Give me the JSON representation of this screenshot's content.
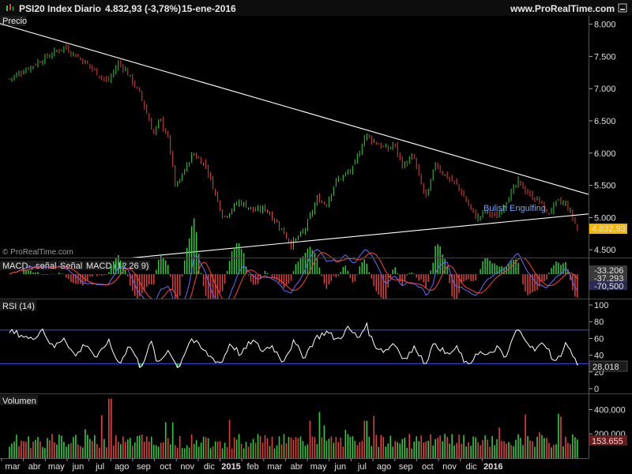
{
  "header": {
    "symbol": "PSI20 Index",
    "period": "Diario",
    "quote": "4.832,93 (-3,78%)",
    "date": "15-ene-2016",
    "site": "www.ProRealTime.com",
    "watermark": "© ProRealTime.com"
  },
  "colors": {
    "up": "#2ecc40",
    "down": "#e04040",
    "price_tag": "#f5b800",
    "rsi_lines": "#3050ff",
    "trend_lines": "#ffffff"
  },
  "chart_data": [
    {
      "type": "candlestick",
      "title": "Precio",
      "ylim": [
        4380,
        8130
      ],
      "yticks": [
        4500,
        5000,
        5500,
        6000,
        6500,
        7000,
        7500,
        8000
      ],
      "ytick_labels": [
        "4.500",
        "5.000",
        "5.500",
        "6.000",
        "6.500",
        "7.000",
        "7.500",
        "8.000"
      ],
      "last_value_label": "4.832,93",
      "last_value": 4832.93,
      "annotation": "Bulish Engulfing",
      "closing_path": [
        {
          "x": 0,
          "y": 7150
        },
        {
          "x": 2.5,
          "y": 7650
        },
        {
          "x": 3.5,
          "y": 7400
        },
        {
          "x": 4.5,
          "y": 7100
        },
        {
          "x": 5.0,
          "y": 7400
        },
        {
          "x": 5.3,
          "y": 7300
        },
        {
          "x": 6.0,
          "y": 6900
        },
        {
          "x": 6.6,
          "y": 6300
        },
        {
          "x": 6.9,
          "y": 6530
        },
        {
          "x": 7.3,
          "y": 6200
        },
        {
          "x": 7.6,
          "y": 5450
        },
        {
          "x": 8.4,
          "y": 6000
        },
        {
          "x": 9.0,
          "y": 5800
        },
        {
          "x": 9.3,
          "y": 5500
        },
        {
          "x": 9.8,
          "y": 5000
        },
        {
          "x": 10.5,
          "y": 5250
        },
        {
          "x": 11.3,
          "y": 5100
        },
        {
          "x": 11.7,
          "y": 5150
        },
        {
          "x": 12.4,
          "y": 4850
        },
        {
          "x": 12.9,
          "y": 4580
        },
        {
          "x": 13.5,
          "y": 4800
        },
        {
          "x": 14.1,
          "y": 5300
        },
        {
          "x": 14.5,
          "y": 5200
        },
        {
          "x": 14.9,
          "y": 5550
        },
        {
          "x": 15.7,
          "y": 5750
        },
        {
          "x": 16.0,
          "y": 6000
        },
        {
          "x": 16.3,
          "y": 6300
        },
        {
          "x": 16.6,
          "y": 6200
        },
        {
          "x": 17.3,
          "y": 6050
        },
        {
          "x": 17.6,
          "y": 6150
        },
        {
          "x": 18.0,
          "y": 5800
        },
        {
          "x": 18.5,
          "y": 5950
        },
        {
          "x": 18.8,
          "y": 5550
        },
        {
          "x": 19.1,
          "y": 5300
        },
        {
          "x": 19.5,
          "y": 5850
        },
        {
          "x": 19.8,
          "y": 5700
        },
        {
          "x": 20.5,
          "y": 5500
        },
        {
          "x": 21.0,
          "y": 5200
        },
        {
          "x": 21.4,
          "y": 4980
        },
        {
          "x": 21.8,
          "y": 5100
        },
        {
          "x": 22.3,
          "y": 5000
        },
        {
          "x": 22.7,
          "y": 5250
        },
        {
          "x": 23.3,
          "y": 5550
        },
        {
          "x": 23.8,
          "y": 5350
        },
        {
          "x": 24.3,
          "y": 5250
        },
        {
          "x": 24.6,
          "y": 5050
        },
        {
          "x": 25.1,
          "y": 5250
        },
        {
          "x": 25.5,
          "y": 5200
        },
        {
          "x": 25.8,
          "y": 4980
        },
        {
          "x": 26.0,
          "y": 4832.93
        }
      ],
      "trendlines": [
        {
          "name": "resistance",
          "x": [
            1.5,
            26.0
          ],
          "y": [
            7820,
            5410
          ]
        },
        {
          "name": "support",
          "x": [
            7.0,
            26.0
          ],
          "y": [
            4420,
            5040
          ]
        }
      ]
    },
    {
      "type": "line",
      "title": "MACD",
      "legend": [
        "MACD-, señal",
        "Señal",
        "MACD (12 26 9)"
      ],
      "ylim": [
        -200,
        120
      ],
      "value_labels": [
        "-33,206",
        "-37,293",
        "-70,500"
      ],
      "values": [
        -33.206,
        -37.293,
        -70.5
      ]
    },
    {
      "type": "line",
      "title": "RSI (14)",
      "ylim": [
        0,
        100
      ],
      "yticks": [
        0,
        20,
        40,
        60,
        80,
        100
      ],
      "ytick_labels": [
        "0",
        "20",
        "40",
        "60",
        "80",
        "100"
      ],
      "bands": [
        30,
        70
      ],
      "last_value_label": "28,018",
      "last_value": 28.018,
      "path": [
        {
          "x": 0,
          "y": 68
        },
        {
          "x": 0.5,
          "y": 65
        },
        {
          "x": 1.0,
          "y": 58
        },
        {
          "x": 1.5,
          "y": 72
        },
        {
          "x": 2.0,
          "y": 48
        },
        {
          "x": 2.5,
          "y": 62
        },
        {
          "x": 3.0,
          "y": 38
        },
        {
          "x": 3.5,
          "y": 55
        },
        {
          "x": 4.0,
          "y": 35
        },
        {
          "x": 4.5,
          "y": 58
        },
        {
          "x": 5.0,
          "y": 30
        },
        {
          "x": 5.5,
          "y": 52
        },
        {
          "x": 6.0,
          "y": 26
        },
        {
          "x": 6.5,
          "y": 55
        },
        {
          "x": 6.8,
          "y": 28
        },
        {
          "x": 7.3,
          "y": 48
        },
        {
          "x": 7.7,
          "y": 24
        },
        {
          "x": 8.3,
          "y": 60
        },
        {
          "x": 8.7,
          "y": 50
        },
        {
          "x": 9.2,
          "y": 38
        },
        {
          "x": 9.7,
          "y": 30
        },
        {
          "x": 10.1,
          "y": 55
        },
        {
          "x": 10.6,
          "y": 40
        },
        {
          "x": 11.1,
          "y": 58
        },
        {
          "x": 11.6,
          "y": 45
        },
        {
          "x": 12.0,
          "y": 52
        },
        {
          "x": 12.5,
          "y": 33
        },
        {
          "x": 13.0,
          "y": 55
        },
        {
          "x": 13.5,
          "y": 38
        },
        {
          "x": 14.0,
          "y": 60
        },
        {
          "x": 14.5,
          "y": 68
        },
        {
          "x": 15.0,
          "y": 58
        },
        {
          "x": 15.5,
          "y": 72
        },
        {
          "x": 16.0,
          "y": 60
        },
        {
          "x": 16.3,
          "y": 78
        },
        {
          "x": 16.7,
          "y": 52
        },
        {
          "x": 17.2,
          "y": 45
        },
        {
          "x": 17.6,
          "y": 55
        },
        {
          "x": 18.1,
          "y": 35
        },
        {
          "x": 18.6,
          "y": 50
        },
        {
          "x": 19.0,
          "y": 30
        },
        {
          "x": 19.5,
          "y": 55
        },
        {
          "x": 20.0,
          "y": 40
        },
        {
          "x": 20.5,
          "y": 48
        },
        {
          "x": 21.0,
          "y": 25
        },
        {
          "x": 21.4,
          "y": 45
        },
        {
          "x": 21.9,
          "y": 38
        },
        {
          "x": 22.3,
          "y": 50
        },
        {
          "x": 22.7,
          "y": 35
        },
        {
          "x": 23.2,
          "y": 70
        },
        {
          "x": 23.6,
          "y": 62
        },
        {
          "x": 24.0,
          "y": 45
        },
        {
          "x": 24.5,
          "y": 55
        },
        {
          "x": 25.0,
          "y": 30
        },
        {
          "x": 25.5,
          "y": 55
        },
        {
          "x": 26.0,
          "y": 28
        }
      ]
    },
    {
      "type": "bar",
      "title": "Volumen",
      "ylim": [
        0,
        520000
      ],
      "yticks": [
        200000,
        400000
      ],
      "ytick_labels": [
        "200.000",
        "400.000"
      ],
      "last_value_label": "153.655",
      "last_value": 153655
    }
  ],
  "x_axis": {
    "labels": [
      "mar",
      "abr",
      "may",
      "jun",
      "jul",
      "ago",
      "sep",
      "oct",
      "nov",
      "dic",
      "2015",
      "feb",
      "mar",
      "abr",
      "may",
      "jun",
      "jul",
      "ago",
      "sep",
      "oct",
      "nov",
      "dic",
      "2016"
    ],
    "bold": [
      "2015",
      "2016"
    ]
  }
}
